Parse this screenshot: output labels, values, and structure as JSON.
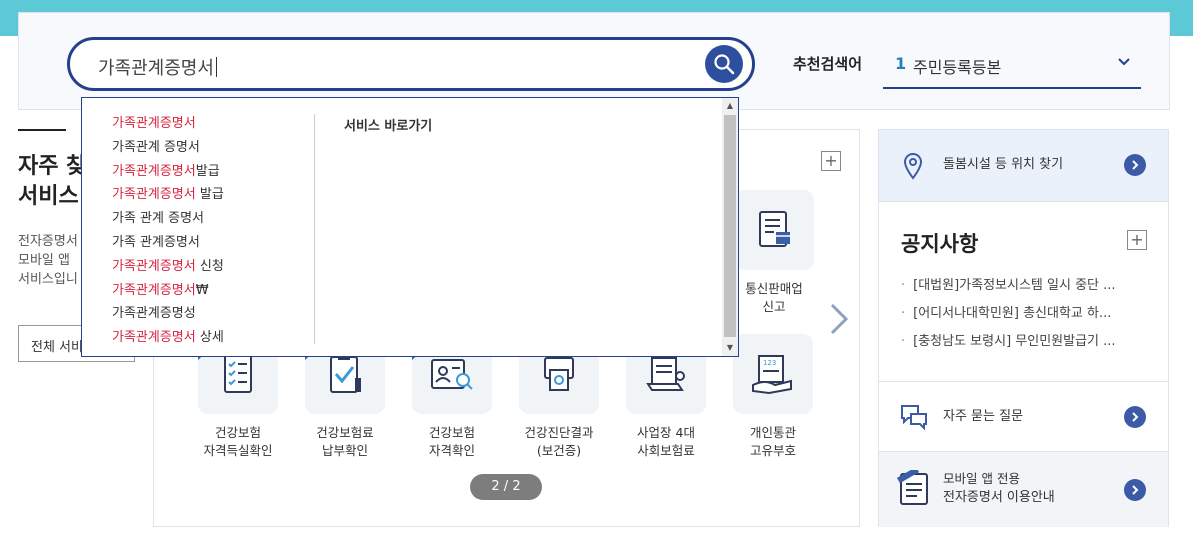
{
  "search": {
    "query": "가족관계증명서",
    "rec_label": "추천검색어",
    "rec_num": "1",
    "rec_text": "주민등록등본"
  },
  "autocomplete": {
    "items": [
      {
        "hl": "가족관계증명서",
        "rest": ""
      },
      {
        "hl": "",
        "rest": "가족관계 증명서"
      },
      {
        "hl": "가족관계증명서",
        "rest": "발급"
      },
      {
        "hl": "가족관계증명서",
        "rest": " 발급"
      },
      {
        "hl": "",
        "rest": "가족 관계 증명서"
      },
      {
        "hl": "",
        "rest": "가족 관계증명서"
      },
      {
        "hl": "가족관계증명서",
        "rest": " 신청"
      },
      {
        "hl": "가족관계증명서",
        "rest": "₩"
      },
      {
        "hl": "",
        "rest": "가족관계증명성"
      },
      {
        "hl": "가족관계증명서",
        "rest": " 상세"
      }
    ],
    "shortcut_title": "서비스 바로가기"
  },
  "left": {
    "title_line1": "자주 찾",
    "title_line2": "서비스",
    "desc_line1": "전자증명서",
    "desc_line2": "모바일 앱",
    "desc_line3": "서비스입니",
    "button": "전체 서비"
  },
  "services": {
    "top_right": {
      "line1": "통신판매업",
      "line2": "신고"
    },
    "bottom": [
      {
        "line1": "건강보험",
        "line2": "자격득실확인"
      },
      {
        "line1": "건강보험료",
        "line2": "납부확인"
      },
      {
        "line1": "건강보험",
        "line2": "자격확인"
      },
      {
        "line1": "건강진단결과",
        "line2": "(보건증)"
      },
      {
        "line1": "사업장 4대",
        "line2": "사회보험료"
      },
      {
        "line1": "개인통관",
        "line2": "고유부호"
      }
    ],
    "pager": "2 / 2"
  },
  "right": {
    "location": "돌봄시설 등 위치 찾기",
    "notice_title": "공지사항",
    "notices": [
      "[대법원]가족정보시스템 일시 중단 ...",
      "[어디서나대학민원] 총신대학교 하...",
      "[충청남도 보령시] 무인민원발급기 ..."
    ],
    "faq": "자주 묻는 질문",
    "mobile_line1": "모바일 앱 전용",
    "mobile_line2": "전자증명서 이용안내"
  },
  "colors": {
    "brand_navy": "#24418f",
    "accent_teal": "#5ec9d6",
    "highlight_red": "#d6263f"
  }
}
